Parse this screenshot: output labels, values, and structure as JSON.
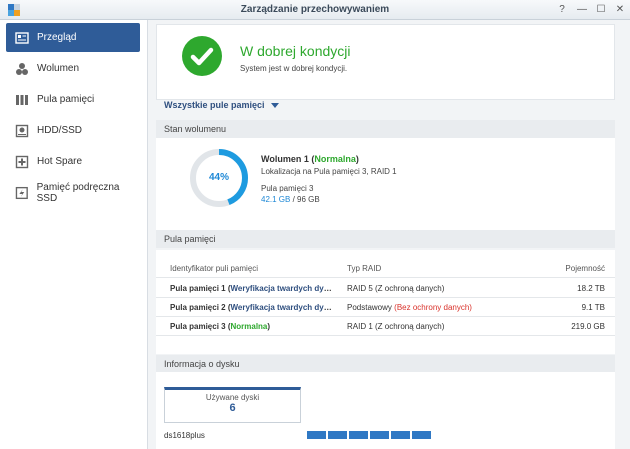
{
  "window": {
    "title": "Zarządzanie przechowywaniem",
    "help": "?",
    "minimize": "—",
    "maximize": "☐",
    "close": "✕"
  },
  "sidebar": {
    "items": [
      {
        "label": "Przegląd",
        "icon": "overview-icon",
        "active": true
      },
      {
        "label": "Wolumen",
        "icon": "volume-icon"
      },
      {
        "label": "Pula pamięci",
        "icon": "storage-pool-icon"
      },
      {
        "label": "HDD/SSD",
        "icon": "hdd-icon"
      },
      {
        "label": "Hot Spare",
        "icon": "hot-spare-icon"
      },
      {
        "label": "Pamięć podręczna SSD",
        "icon": "ssd-cache-icon"
      }
    ]
  },
  "health": {
    "title": "W dobrej kondycji",
    "subtitle": "System jest w dobrej kondycji.",
    "icon": "checkmark-icon",
    "color": "#2ea82e"
  },
  "pool_selector": {
    "label": "Wszystkie pule pamięci"
  },
  "volume_section": {
    "heading": "Stan wolumenu",
    "usage_percent": 44,
    "usage_label": "44%",
    "name": "Wolumen 1",
    "status": "Normalna",
    "location": "Lokalizacja na Pula pamięci 3, RAID 1",
    "pool": "Pula pamięci 3",
    "used": "42.1 GB",
    "total": "/ 96 GB"
  },
  "pool_section": {
    "heading": "Pula pamięci",
    "columns": [
      "Identyfikator puli pamięci",
      "Typ RAID",
      "Pojemność"
    ],
    "rows": [
      {
        "name": "Pula pamięci 1",
        "status": "Weryfikacja twardych dysków",
        "status_color": "#2f4f7f",
        "raid": "RAID 5 (Z ochroną danych)",
        "raid_note": "",
        "capacity": "18.2 TB"
      },
      {
        "name": "Pula pamięci 2",
        "status": "Weryfikacja twardych dysków",
        "status_color": "#2f4f7f",
        "raid": "Podstawowy",
        "raid_note": "(Bez ochrony danych)",
        "capacity": "9.1 TB"
      },
      {
        "name": "Pula pamięci 3",
        "status": "Normalna",
        "status_color": "#2ea82e",
        "raid": "RAID 1 (Z ochroną danych)",
        "raid_note": "",
        "capacity": "219.0 GB"
      }
    ]
  },
  "disk_section": {
    "heading": "Informacja o dysku",
    "used_label": "Używane dyski",
    "used_count": "6",
    "device": "ds1618plus",
    "slots": 6
  }
}
